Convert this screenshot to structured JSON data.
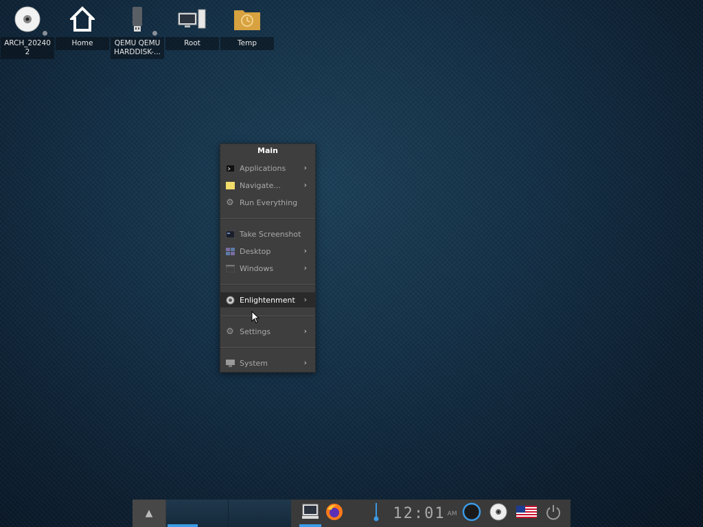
{
  "desktop": {
    "icons": [
      {
        "label": "ARCH_202402",
        "icon": "optical-disc-icon"
      },
      {
        "label": "Home",
        "icon": "home-icon"
      },
      {
        "label": "QEMU QEMU HARDDISK-...",
        "icon": "usb-drive-icon"
      },
      {
        "label": "Root",
        "icon": "computer-icon"
      },
      {
        "label": "Temp",
        "icon": "temp-folder-icon"
      }
    ]
  },
  "menu": {
    "title": "Main",
    "items": [
      {
        "label": "Applications",
        "icon": "terminal-icon",
        "submenu": true
      },
      {
        "label": "Navigate...",
        "icon": "folder-icon",
        "submenu": true
      },
      {
        "label": "Run Everything",
        "icon": "gear-icon",
        "submenu": false
      },
      {
        "label": "Take Screenshot",
        "icon": "screenshot-icon",
        "submenu": false
      },
      {
        "label": "Desktop",
        "icon": "desktop-icon",
        "submenu": true
      },
      {
        "label": "Windows",
        "icon": "windows-icon",
        "submenu": true
      },
      {
        "label": "Enlightenment",
        "icon": "enlightenment-icon",
        "submenu": true,
        "active": true
      },
      {
        "label": "Settings",
        "icon": "settings-gear-icon",
        "submenu": true
      },
      {
        "label": "System",
        "icon": "system-monitor-icon",
        "submenu": true
      }
    ],
    "arrow": "›"
  },
  "taskbar": {
    "clock_time": "12:01",
    "clock_ampm": "AM",
    "accent": "#3c9be6"
  }
}
